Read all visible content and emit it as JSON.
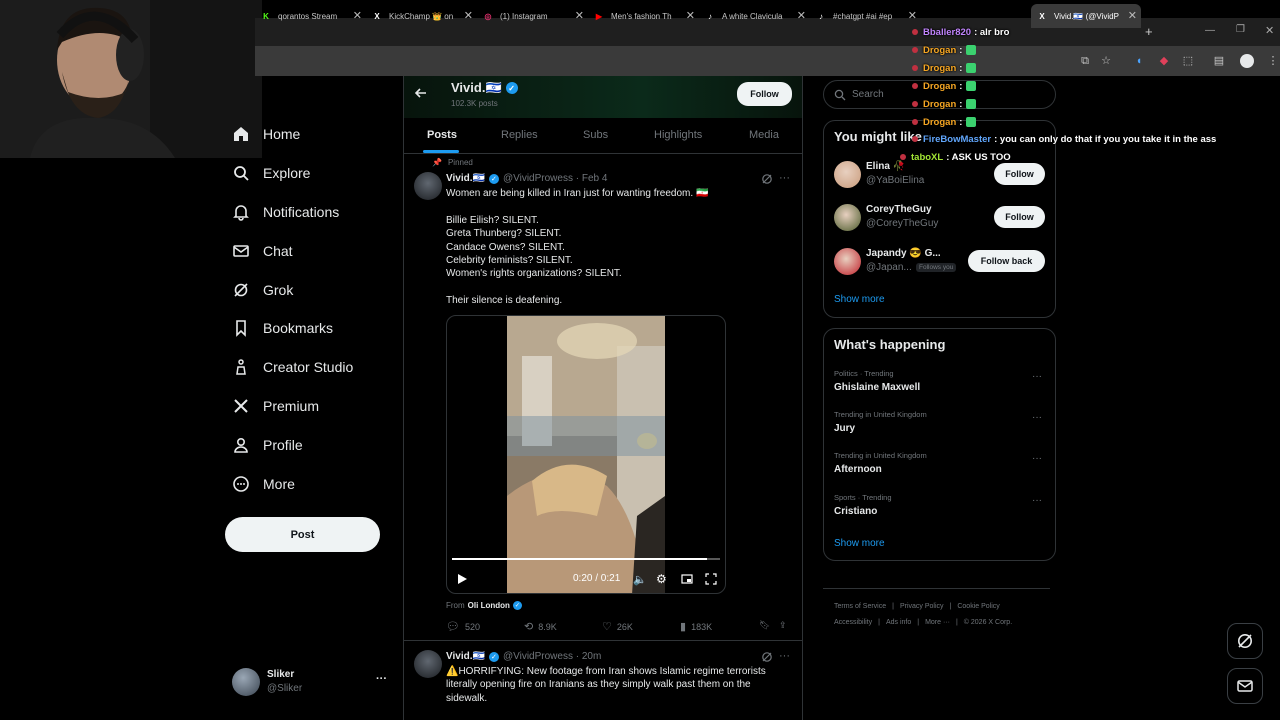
{
  "browser": {
    "tabs": [
      {
        "label": "qorantos Stream",
        "icon": "kick-icon",
        "color": "#53fc18"
      },
      {
        "label": "KickChamp 👑 on",
        "icon": "x-icon",
        "color": "#ffffff"
      },
      {
        "label": "(1) Instagram",
        "icon": "instagram-icon",
        "color": "#e1306c"
      },
      {
        "label": "Men's fashion Th",
        "icon": "youtube-icon",
        "color": "#ff0000"
      },
      {
        "label": "A white Clavicula",
        "icon": "tiktok-icon",
        "color": "#ffffff"
      },
      {
        "label": "#chatgpt #ai #ep",
        "icon": "tiktok-icon",
        "color": "#ffffff"
      },
      {
        "label": "Vivid.🇮🇱 (@VividP",
        "icon": "x-icon",
        "color": "#ffffff"
      }
    ],
    "new_tab": "+",
    "close": "✕"
  },
  "stream_chat": [
    {
      "user": "Bballer820",
      "msg": ": alr bro",
      "color": "#c084fc"
    },
    {
      "user": "Drogan",
      "msg": ":",
      "color": "#f5a623"
    },
    {
      "user": "Drogan",
      "msg": ":",
      "color": "#f5a623"
    },
    {
      "user": "Drogan",
      "msg": ":",
      "color": "#f5a623"
    },
    {
      "user": "Drogan",
      "msg": ":",
      "color": "#f5a623"
    },
    {
      "user": "Drogan",
      "msg": ":",
      "color": "#f5a623"
    },
    {
      "user": "FireBowMaster",
      "msg": ": you can only do that if you you take it in the ass",
      "color": "#60a5fa"
    },
    {
      "user": "taboXL",
      "msg": ": ASK US TOO",
      "color": "#a3e635"
    }
  ],
  "nav": {
    "items": [
      {
        "label": "Home",
        "icon": "home-icon"
      },
      {
        "label": "Explore",
        "icon": "search-icon"
      },
      {
        "label": "Notifications",
        "icon": "bell-icon"
      },
      {
        "label": "Chat",
        "icon": "mail-icon"
      },
      {
        "label": "Grok",
        "icon": "grok-icon"
      },
      {
        "label": "Bookmarks",
        "icon": "bookmark-icon"
      },
      {
        "label": "Creator Studio",
        "icon": "creator-icon"
      },
      {
        "label": "Premium",
        "icon": "x-icon"
      },
      {
        "label": "Profile",
        "icon": "person-icon"
      },
      {
        "label": "More",
        "icon": "more-circle-icon"
      }
    ],
    "post_label": "Post",
    "account": {
      "name": "Sliker",
      "handle": "@Sliker",
      "more": "···"
    }
  },
  "profile": {
    "name": "Vivid.🇮🇱",
    "posts_count": "102.3K posts",
    "follow_label": "Follow",
    "tabs": [
      "Posts",
      "Replies",
      "Subs",
      "Highlights",
      "Media"
    ],
    "active_tab": "Posts"
  },
  "posts": [
    {
      "pinned_label": "Pinned",
      "name": "Vivid.🇮🇱",
      "handle_time": "@VividProwess · Feb 4",
      "lines": [
        "Women are being killed in Iran just for wanting freedom. 🇮🇷",
        "",
        "Billie Eilish? SILENT.",
        "Greta Thunberg? SILENT.",
        "Candace Owens? SILENT.",
        "Celebrity feminists? SILENT.",
        "Women's rights organizations? SILENT.",
        "",
        "Their silence is deafening."
      ],
      "video": {
        "time": "0:20 / 0:21",
        "progress": 0.95
      },
      "from_label": "From",
      "from_name": "Oli London",
      "stats": {
        "replies": "520",
        "reposts": "8.9K",
        "likes": "26K",
        "views": "183K"
      }
    },
    {
      "name": "Vivid.🇮🇱",
      "handle_time": "@VividProwess · 20m",
      "lines": [
        "⚠️HORRIFYING: New footage from Iran shows Islamic regime terrorists",
        "literally opening fire on Iranians as they simply walk past them on the",
        "sidewalk."
      ]
    }
  ],
  "search": {
    "placeholder": "Search"
  },
  "who_to_follow": {
    "title": "You might like",
    "users": [
      {
        "name": "Elina 🥀",
        "handle": "@YaBoiElina",
        "btn": "Follow",
        "color": "#c89a7a"
      },
      {
        "name": "CoreyTheGuy",
        "handle": "@CoreyTheGuy",
        "btn": "Follow",
        "color": "#4a5a2a"
      },
      {
        "name": "Japandy 😎 G...",
        "handle": "@Japan...",
        "follows_you": "Follows you",
        "btn": "Follow back",
        "color": "#c0202a"
      }
    ],
    "show_more": "Show more"
  },
  "trends": {
    "title": "What's happening",
    "items": [
      {
        "context": "Politics · Trending",
        "topic": "Ghislaine Maxwell"
      },
      {
        "context": "Trending in United Kingdom",
        "topic": "Jury"
      },
      {
        "context": "Trending in United Kingdom",
        "topic": "Afternoon"
      },
      {
        "context": "Sports · Trending",
        "topic": "Cristiano"
      }
    ],
    "show_more": "Show more"
  },
  "footer": {
    "row1": [
      "Terms of Service",
      "Privacy Policy",
      "Cookie Policy"
    ],
    "row2": [
      "Accessibility",
      "Ads info",
      "More ···",
      "© 2026 X Corp."
    ]
  },
  "colors": {
    "accent": "#1d9bf0",
    "border": "#2f3336",
    "muted": "#71767b"
  }
}
